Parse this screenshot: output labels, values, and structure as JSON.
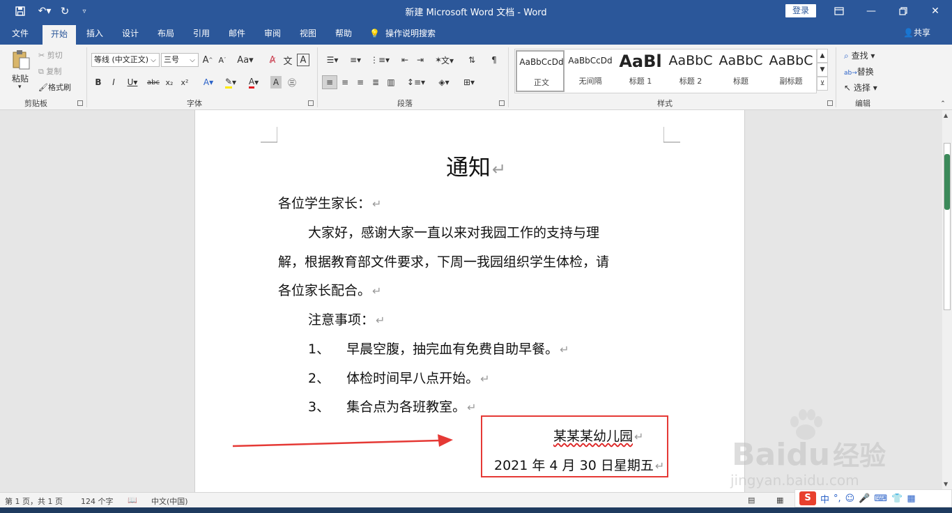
{
  "window": {
    "title": "新建 Microsoft Word 文档 - Word",
    "login_label": "登录",
    "share_label": "共享",
    "accent": "#2b579a"
  },
  "tabs": [
    {
      "label": "文件"
    },
    {
      "label": "开始",
      "active": true
    },
    {
      "label": "插入"
    },
    {
      "label": "设计"
    },
    {
      "label": "布局"
    },
    {
      "label": "引用"
    },
    {
      "label": "邮件"
    },
    {
      "label": "审阅"
    },
    {
      "label": "视图"
    },
    {
      "label": "帮助"
    }
  ],
  "tell_me": "操作说明搜索",
  "ribbon": {
    "clipboard": {
      "group": "剪贴板",
      "paste": "粘贴",
      "cut": "剪切",
      "copy": "复制",
      "format_painter": "格式刷"
    },
    "font": {
      "group": "字体",
      "font_name": "等线 (中文正文)",
      "font_size": "三号"
    },
    "paragraph": {
      "group": "段落"
    },
    "styles": {
      "group": "样式",
      "items": [
        {
          "preview": "AaBbCcDd",
          "name": "正文",
          "selected": true
        },
        {
          "preview": "AaBbCcDd",
          "name": "无间隔"
        },
        {
          "preview": "AaBl",
          "name": "标题 1"
        },
        {
          "preview": "AaBbC",
          "name": "标题 2"
        },
        {
          "preview": "AaBbC",
          "name": "标题"
        },
        {
          "preview": "AaBbC",
          "name": "副标题"
        }
      ]
    },
    "editing": {
      "group": "编辑",
      "find": "查找",
      "replace": "替换",
      "select": "选择"
    }
  },
  "document": {
    "title": "通知",
    "greeting": "各位学生家长：",
    "para1_line1": "大家好，感谢大家一直以来对我园工作的支持与理",
    "para1_line2": "解，根据教育部文件要求，下周一我园组织学生体检，请",
    "para1_line3": "各位家长配合。",
    "notes_heading": "注意事项：",
    "items": [
      {
        "num": "1、",
        "text": "早晨空腹，抽完血有免费自助早餐。"
      },
      {
        "num": "2、",
        "text": "体检时间早八点开始。"
      },
      {
        "num": "3、",
        "text": "集合点为各班教室。"
      }
    ],
    "signature": "某某某幼儿园",
    "date": "2021 年 4 月 30 日星期五",
    "annotation_color": "#e53935"
  },
  "status": {
    "page": "第 1 页，共 1 页",
    "words": "124 个字",
    "language": "中文(中国)"
  },
  "watermark": {
    "brand": "Baidu",
    "brand_cn": "经验",
    "url": "jingyan.baidu.com"
  },
  "ime": {
    "label": "中"
  }
}
